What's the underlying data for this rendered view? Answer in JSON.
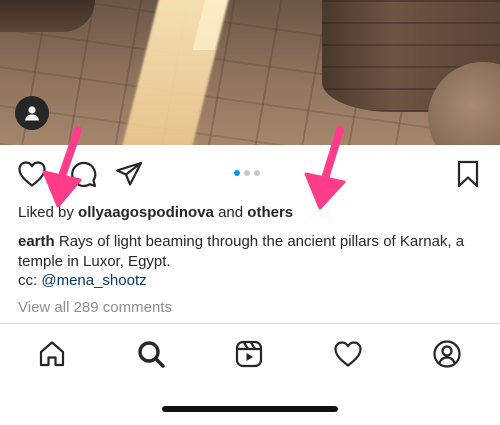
{
  "post": {
    "likes_prefix": "Liked by",
    "liked_by_user": "ollyaagospodinova",
    "likes_and": "and",
    "likes_others": "others",
    "author": "earth",
    "caption_text": "Rays of light beaming through the ancient pillars of Karnak, a temple in Luxor, Egypt.",
    "cc_prefix": "cc:",
    "cc_mention": "@mena_shootz",
    "view_comments": "View all 289 comments",
    "carousel": {
      "total": 3,
      "active_index": 0
    }
  },
  "actions": [
    "heart-icon",
    "comment-icon",
    "share-icon",
    "bookmark-icon"
  ],
  "tabs": [
    "home-icon",
    "search-icon",
    "reels-icon",
    "activity-heart-icon",
    "profile-icon"
  ],
  "colors": {
    "annotation_arrow": "#ff3d8b",
    "carousel_active": "#0095f6",
    "mention": "#00376b"
  }
}
